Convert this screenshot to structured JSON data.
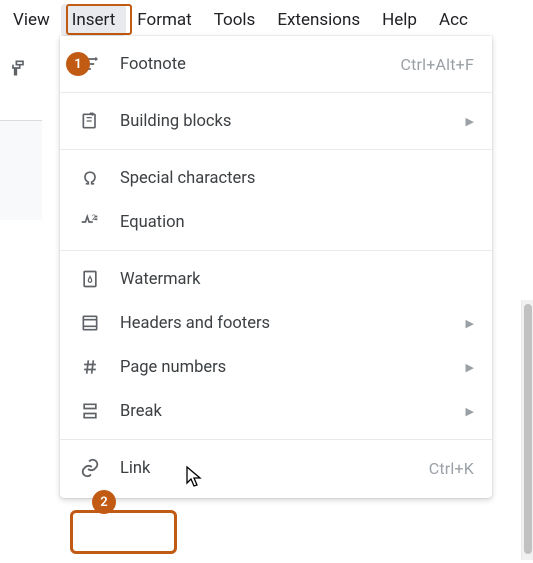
{
  "menubar": {
    "items": [
      "View",
      "Insert",
      "Format",
      "Tools",
      "Extensions",
      "Help",
      "Acc"
    ]
  },
  "dropdown": {
    "footnote": {
      "label": "Footnote",
      "shortcut": "Ctrl+Alt+F"
    },
    "building_blocks": {
      "label": "Building blocks"
    },
    "special_chars": {
      "label": "Special characters"
    },
    "equation": {
      "label": "Equation"
    },
    "watermark": {
      "label": "Watermark"
    },
    "headers_footers": {
      "label": "Headers and footers"
    },
    "page_numbers": {
      "label": "Page numbers"
    },
    "break": {
      "label": "Break"
    },
    "link": {
      "label": "Link",
      "shortcut": "Ctrl+K"
    }
  },
  "badges": {
    "one": "1",
    "two": "2"
  }
}
